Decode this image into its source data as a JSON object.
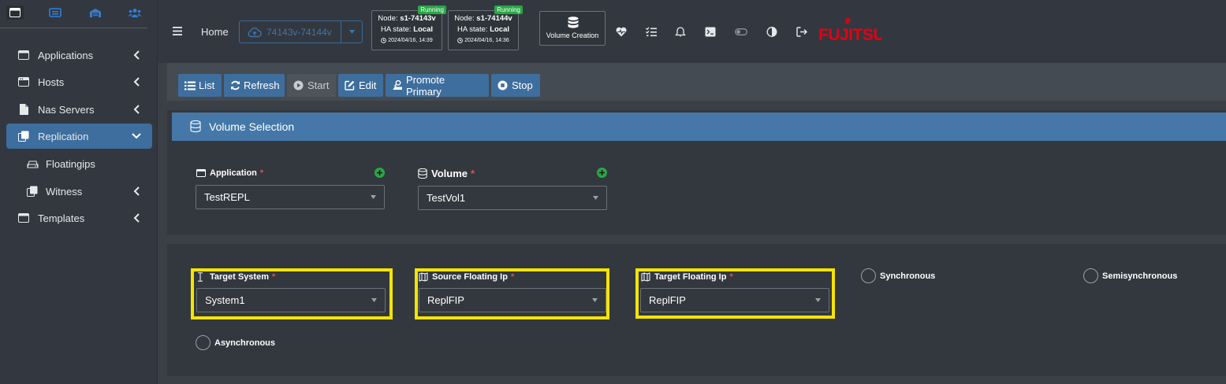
{
  "sidebar": {
    "items": [
      {
        "label": "Applications",
        "icon": "window-icon"
      },
      {
        "label": "Hosts",
        "icon": "server-icon"
      },
      {
        "label": "Nas Servers",
        "icon": "file-icon"
      },
      {
        "label": "Replication",
        "icon": "copy-icon",
        "active": true
      },
      {
        "label": "Floatingips",
        "icon": "hdd-icon"
      },
      {
        "label": "Witness",
        "icon": "copy-icon"
      },
      {
        "label": "Templates",
        "icon": "window-icon"
      }
    ]
  },
  "topbar": {
    "home": "Home",
    "cluster": "74143v-74144v",
    "nodes": [
      {
        "badge": "Running",
        "node_label": "Node:",
        "node_name": "s1-74143v",
        "ha_label": "HA state:",
        "ha_state": "Local",
        "time": "2024/04/16, 14:39"
      },
      {
        "badge": "Running",
        "node_label": "Node:",
        "node_name": "s1-74144v",
        "ha_label": "HA state:",
        "ha_state": "Local",
        "time": "2024/04/16, 14:36"
      }
    ],
    "volume_creation": "Volume Creation",
    "brand": "FUJITSU",
    "brand_color": "#e60012"
  },
  "actions": {
    "list": "List",
    "refresh": "Refresh",
    "start": "Start",
    "edit": "Edit",
    "promote": "Promote Primary",
    "stop": "Stop"
  },
  "volume_selection": {
    "title": "Volume Selection",
    "application_label": "Application",
    "application_value": "TestREPL",
    "volume_label": "Volume",
    "volume_value": "TestVol1"
  },
  "replication": {
    "target_system_label": "Target System",
    "target_system_value": "System1",
    "source_fip_label": "Source Floating Ip",
    "source_fip_value": "ReplFIP",
    "target_fip_label": "Target Floating Ip",
    "target_fip_value": "ReplFIP",
    "mode_synchronous": "Synchronous",
    "mode_semisynchronous": "Semisynchronous",
    "mode_asynchronous": "Asynchronous"
  },
  "colors": {
    "accent": "#3e6e9d",
    "highlight": "#f5e400",
    "required": "#d9534f",
    "add": "#28a745"
  }
}
